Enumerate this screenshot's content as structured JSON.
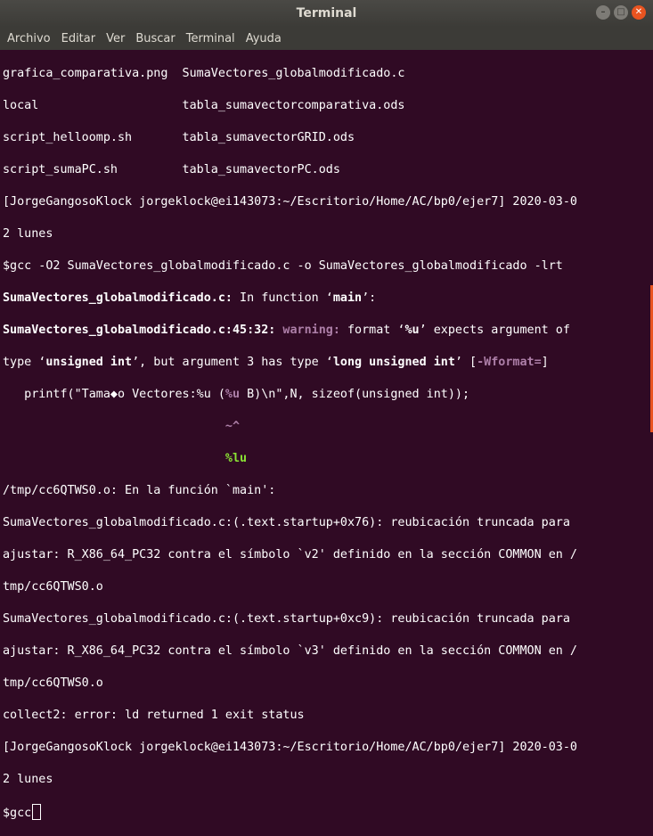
{
  "window": {
    "title": "Terminal"
  },
  "menu": [
    "Archivo",
    "Editar",
    "Ver",
    "Buscar",
    "Terminal",
    "Ayuda"
  ],
  "terminal": {
    "l1": "grafica_comparativa.png  SumaVectores_globalmodificado.c",
    "l2": "local                    tabla_sumavectorcomparativa.ods",
    "l3": "script_helloomp.sh       tabla_sumavectorGRID.ods",
    "l4": "script_sumaPC.sh         tabla_sumavectorPC.ods",
    "l5": "[JorgeGangosoKlock jorgeklock@ei143073:~/Escritorio/Home/AC/bp0/ejer7] 2020-03-0",
    "l6": "2 lunes",
    "l7": "$gcc -O2 SumaVectores_globalmodificado.c -o SumaVectores_globalmodificado -lrt",
    "l8a": "SumaVectores_globalmodificado.c:",
    "l8b": " In function ‘",
    "l8c": "main",
    "l8d": "’:",
    "l9a": "SumaVectores_globalmodificado.c:45:32:",
    "l9b": " ",
    "l9c": "warning:",
    "l9d": " format ‘",
    "l9e": "%u",
    "l9f": "’ expects argument of",
    "l10a": "type ‘",
    "l10b": "unsigned int",
    "l10c": "’, but argument 3 has type ‘",
    "l10d": "long unsigned int",
    "l10e": "’ [",
    "l10f": "-Wformat=",
    "l10g": "]",
    "l11a": "   printf(\"Tama◆o Vectores:%u (",
    "l11b": "%u",
    "l11c": " B)\\n\",N, sizeof(unsigned int));",
    "l12pad": "                               ",
    "l12": "~^",
    "l13pad": "                               ",
    "l13": "%lu",
    "l14": "/tmp/cc6QTWS0.o: En la función `main':",
    "l15": "SumaVectores_globalmodificado.c:(.text.startup+0x76): reubicación truncada para",
    "l16": "ajustar: R_X86_64_PC32 contra el símbolo `v2' definido en la sección COMMON en /",
    "l17": "tmp/cc6QTWS0.o",
    "l18": "SumaVectores_globalmodificado.c:(.text.startup+0xc9): reubicación truncada para",
    "l19": "ajustar: R_X86_64_PC32 contra el símbolo `v3' definido en la sección COMMON en /",
    "l20": "tmp/cc6QTWS0.o",
    "l21": "collect2: error: ld returned 1 exit status",
    "l22": "[JorgeGangosoKlock jorgeklock@ei143073:~/Escritorio/Home/AC/bp0/ejer7] 2020-03-0",
    "l23": "2 lunes",
    "l24": "$gcc"
  }
}
